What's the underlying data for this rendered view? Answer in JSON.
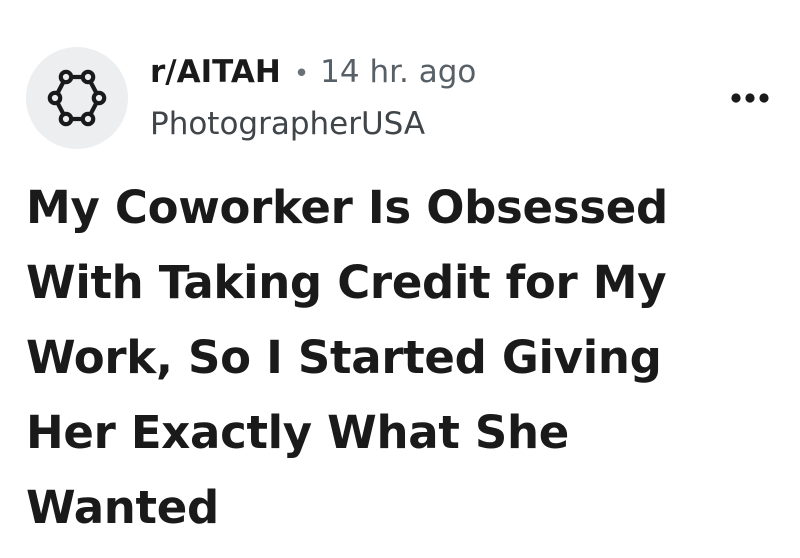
{
  "post": {
    "subreddit": "r/AITAH",
    "separator": "•",
    "time_ago": "14 hr. ago",
    "author": "PhotographerUSA",
    "title": "My Coworker Is Obsessed With Taking Credit for My Work, So I Started Giving Her Exactly What She Wanted"
  },
  "icons": {
    "avatar": "subreddit-network-icon",
    "menu": "more-options-icon"
  },
  "colors": {
    "avatar_bg": "#eceeef",
    "text_primary": "#1a1a1b",
    "text_secondary": "#576067"
  }
}
